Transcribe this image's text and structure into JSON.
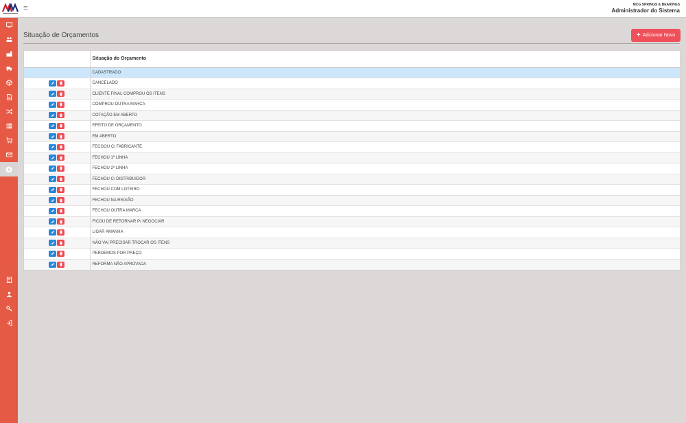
{
  "header": {
    "company": "MCG SPRINGS & BEARINGS",
    "user_role": "Administrador do Sistema",
    "menu_icon": "hamburger-icon",
    "logo": "company-logo"
  },
  "sidebar": {
    "top_icons": [
      "monitor-icon",
      "users-icon",
      "factory-icon",
      "truck-icon",
      "cube-icon",
      "document-icon",
      "shuffle-icon",
      "list-icon",
      "cart-icon",
      "envelope-icon",
      "plus-circle-icon"
    ],
    "bottom_icons": [
      "report-icon",
      "user-icon",
      "key-icon",
      "logout-icon"
    ],
    "active_icon": "plus-circle-icon"
  },
  "page": {
    "title": "Situação de Orçamentos",
    "add_button_label": "Adicionar Novo"
  },
  "table": {
    "column_header": "Situação do Orçamento",
    "rows": [
      "CADASTRADO",
      "CANCELADO",
      "CLIENTE FINAL COMPROU OS ITENS",
      "COMPROU OUTRA MARCA",
      "COTAÇÃO EM ABERTO",
      "EFEITO DE ORÇAMENTO",
      "EM ABERTO",
      "FECGOU C/ FABRICANTE",
      "FECHOU 1ª LINHA",
      "FECHOU 2ª LINHA",
      "FECHOU C/ DISTRIBUIDOR",
      "FECHOU COM LOTEIRO",
      "FECHOU NA REGIÃO",
      "FECHOU OUTRA MARCA",
      "FICOU DE RETORNAR P/ NEGOCIAR",
      "LIGAR AMANHA",
      "NÃO VAI PRECISAR TROCAR OS ITENS",
      "PERDEMOS POR PREÇO",
      "REFORMA NÃO APROVADA"
    ],
    "selected_row": 0,
    "accent_edit": "#2b86d9",
    "accent_delete": "#ee4a52"
  },
  "colors": {
    "sidebar": "#e65a45",
    "background": "#dcd8d8",
    "add_button": "#f0505a",
    "selected_row": "#cce7fb"
  }
}
